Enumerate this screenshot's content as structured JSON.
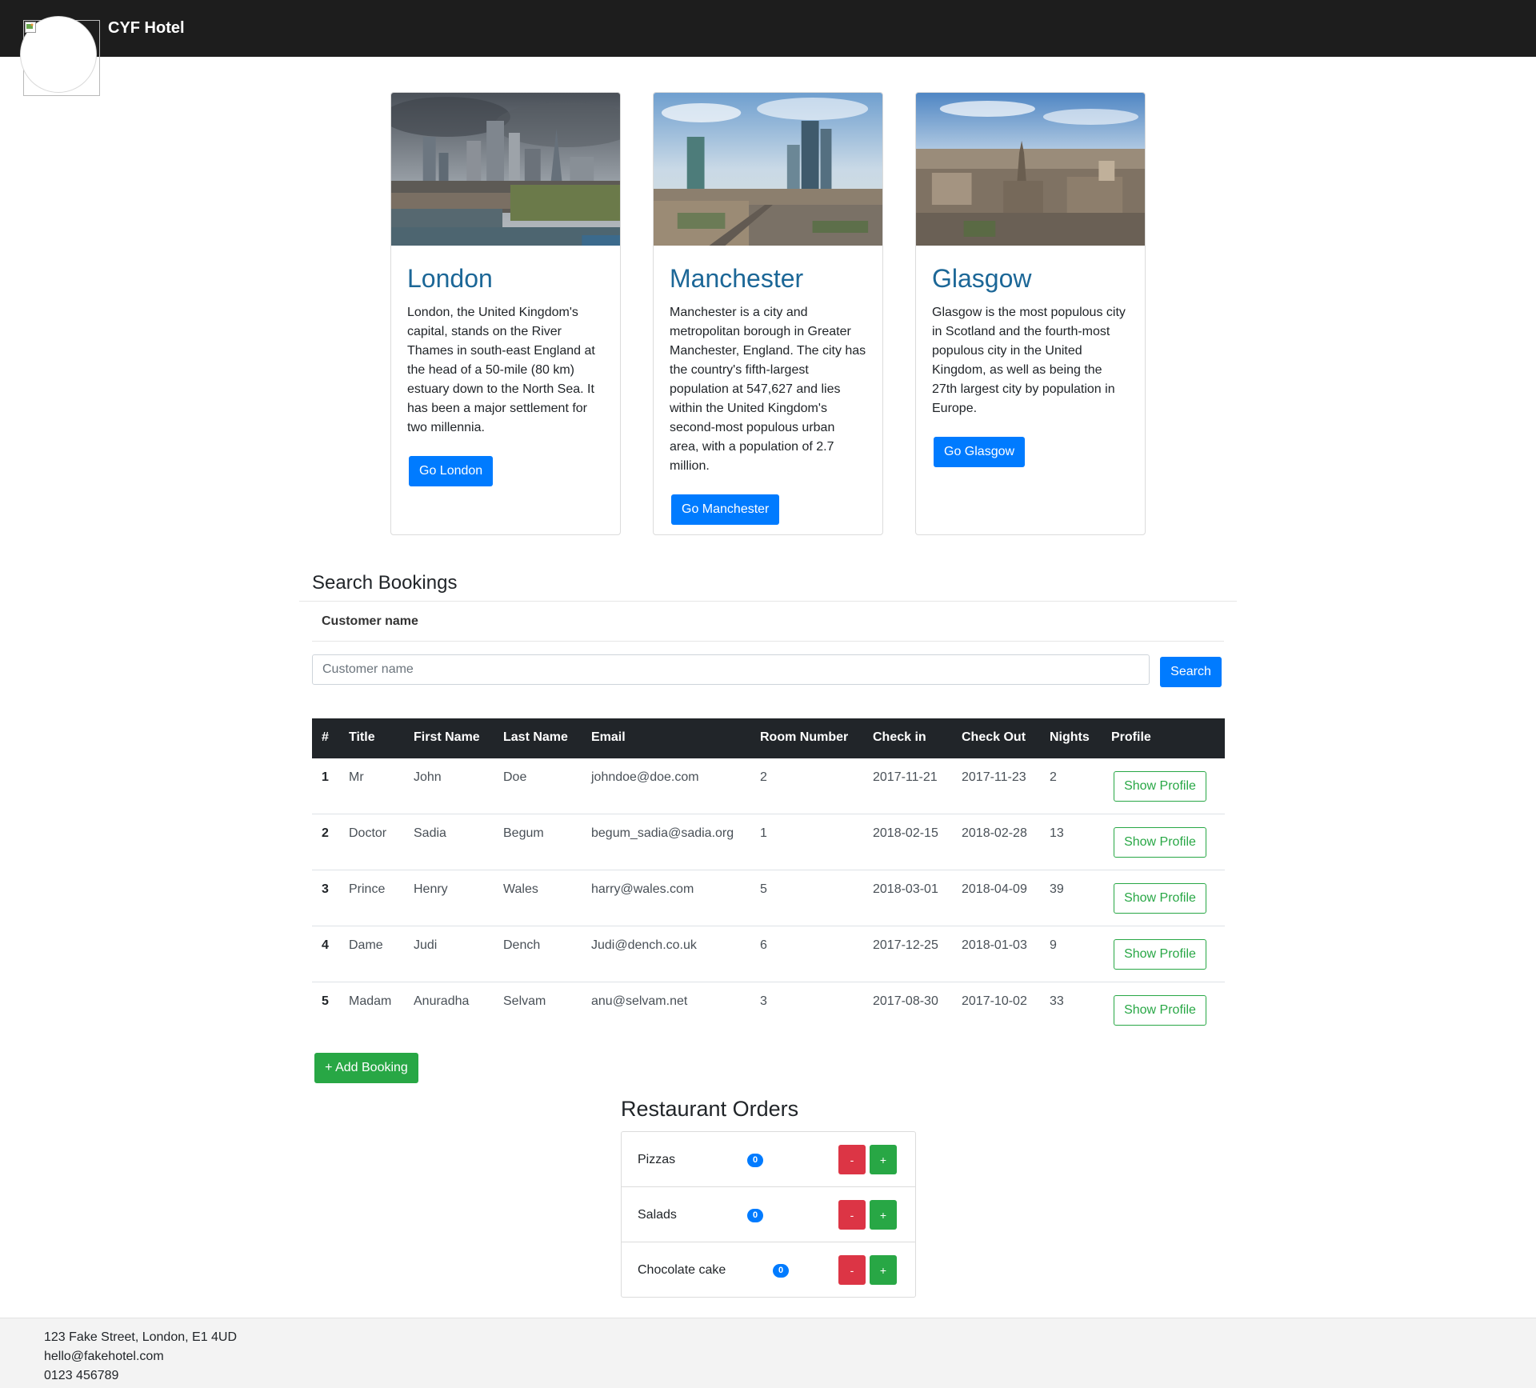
{
  "header": {
    "brand": "CYF Hotel"
  },
  "cities": [
    {
      "name": "London",
      "description": "London, the United Kingdom's capital, stands on the River Thames in south-east England at the head of a 50-mile (80 km) estuary down to the North Sea. It has been a major settlement for two millennia.",
      "button": "Go London"
    },
    {
      "name": "Manchester",
      "description": "Manchester is a city and metropolitan borough in Greater Manchester, England. The city has the country's fifth-largest population at 547,627 and lies within the United Kingdom's second-most populous urban area, with a population of 2.7 million.",
      "button": "Go Manchester"
    },
    {
      "name": "Glasgow",
      "description": "Glasgow is the most populous city in Scotland and the fourth-most populous city in the United Kingdom, as well as being the 27th largest city by population in Europe.",
      "button": "Go Glasgow"
    }
  ],
  "search": {
    "title": "Search Bookings",
    "label": "Customer name",
    "placeholder": "Customer name",
    "button": "Search"
  },
  "bookings": {
    "columns": [
      "#",
      "Title",
      "First Name",
      "Last Name",
      "Email",
      "Room Number",
      "Check in",
      "Check Out",
      "Nights",
      "Profile"
    ],
    "rows": [
      {
        "id": "1",
        "title": "Mr",
        "first": "John",
        "last": "Doe",
        "email": "johndoe@doe.com",
        "room": "2",
        "checkin": "2017-11-21",
        "checkout": "2017-11-23",
        "nights": "2",
        "profile": "Show Profile"
      },
      {
        "id": "2",
        "title": "Doctor",
        "first": "Sadia",
        "last": "Begum",
        "email": "begum_sadia@sadia.org",
        "room": "1",
        "checkin": "2018-02-15",
        "checkout": "2018-02-28",
        "nights": "13",
        "profile": "Show Profile"
      },
      {
        "id": "3",
        "title": "Prince",
        "first": "Henry",
        "last": "Wales",
        "email": "harry@wales.com",
        "room": "5",
        "checkin": "2018-03-01",
        "checkout": "2018-04-09",
        "nights": "39",
        "profile": "Show Profile"
      },
      {
        "id": "4",
        "title": "Dame",
        "first": "Judi",
        "last": "Dench",
        "email": "Judi@dench.co.uk",
        "room": "6",
        "checkin": "2017-12-25",
        "checkout": "2018-01-03",
        "nights": "9",
        "profile": "Show Profile"
      },
      {
        "id": "5",
        "title": "Madam",
        "first": "Anuradha",
        "last": "Selvam",
        "email": "anu@selvam.net",
        "room": "3",
        "checkin": "2017-08-30",
        "checkout": "2017-10-02",
        "nights": "33",
        "profile": "Show Profile"
      }
    ],
    "add_button": "+ Add Booking"
  },
  "restaurant": {
    "title": "Restaurant Orders",
    "items": [
      {
        "name": "Pizzas",
        "count": "0",
        "minus": "-",
        "plus": "+"
      },
      {
        "name": "Salads",
        "count": "0",
        "minus": "-",
        "plus": "+"
      },
      {
        "name": "Chocolate cake",
        "count": "0",
        "minus": "-",
        "plus": "+"
      }
    ]
  },
  "footer": {
    "address": "123 Fake Street, London, E1 4UD",
    "email": "hello@fakehotel.com",
    "phone": "0123 456789"
  },
  "colors": {
    "header_bg": "#1d1d1d",
    "primary": "#007bff",
    "success": "#28a745",
    "danger": "#dc3545",
    "card_title": "#1c6797",
    "footer_bg": "#f3f3f3"
  }
}
